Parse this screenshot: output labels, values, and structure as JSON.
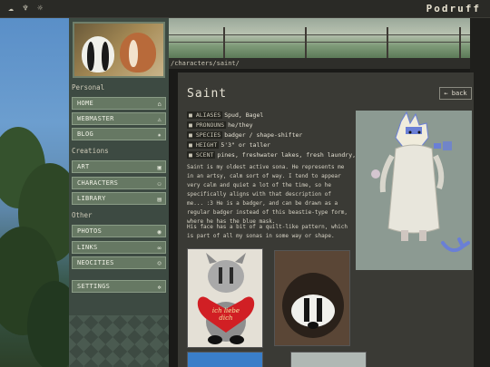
{
  "site": {
    "logo": "Podruff"
  },
  "path": "/characters/saint/",
  "sidebar": {
    "personal_label": "Personal",
    "creations_label": "Creations",
    "other_label": "Other",
    "personal": [
      {
        "label": "HOME",
        "icon": "home-icon",
        "glyph": "⌂"
      },
      {
        "label": "WEBMASTER",
        "icon": "warning-icon",
        "glyph": "⚠"
      },
      {
        "label": "BLOG",
        "icon": "bug-icon",
        "glyph": "✷"
      }
    ],
    "creations": [
      {
        "label": "ART",
        "icon": "image-icon",
        "glyph": "▣"
      },
      {
        "label": "CHARACTERS",
        "icon": "people-icon",
        "glyph": "⚇"
      },
      {
        "label": "LIBRARY",
        "icon": "book-icon",
        "glyph": "▤"
      }
    ],
    "other": [
      {
        "label": "PHOTOS",
        "icon": "camera-icon",
        "glyph": "◉"
      },
      {
        "label": "LINKS",
        "icon": "link-icon",
        "glyph": "∞"
      },
      {
        "label": "NEOCITIES",
        "icon": "cat-icon",
        "glyph": "☺"
      }
    ],
    "settings": {
      "label": "SETTINGS",
      "icon": "gear-icon",
      "glyph": "✲"
    }
  },
  "main": {
    "title": "Saint",
    "back_label": "← back",
    "info": [
      {
        "key": "ALIASES",
        "value": "Spud, Bagel"
      },
      {
        "key": "PRONOUNS",
        "value": "he/they"
      },
      {
        "key": "SPECIES",
        "value": "badger / shape-shifter"
      },
      {
        "key": "HEIGHT",
        "value": "5'3\" or taller"
      },
      {
        "key": "SCENT",
        "value": "pines, freshwater lakes, fresh laundry, smoke"
      }
    ],
    "para1": "Saint is my oldest active sona. He represents me in an artsy, calm sort of way. I tend to appear very calm and quiet a lot of the time, so he specifically aligns with that description of me... :3 He is a badger, and can be drawn as a regular badger instead of this beastie-type form, where he has the blue mask.",
    "para2": "His face has a bit of a quilt-like pattern, which is part of all my sonas in some way or shape.",
    "plush_text": "ich liebe dich"
  },
  "colors": {
    "sidebar": "#3d4a42",
    "button": "#667863",
    "content": "#3a3a35",
    "accent_blue": "#6a7fd6"
  }
}
